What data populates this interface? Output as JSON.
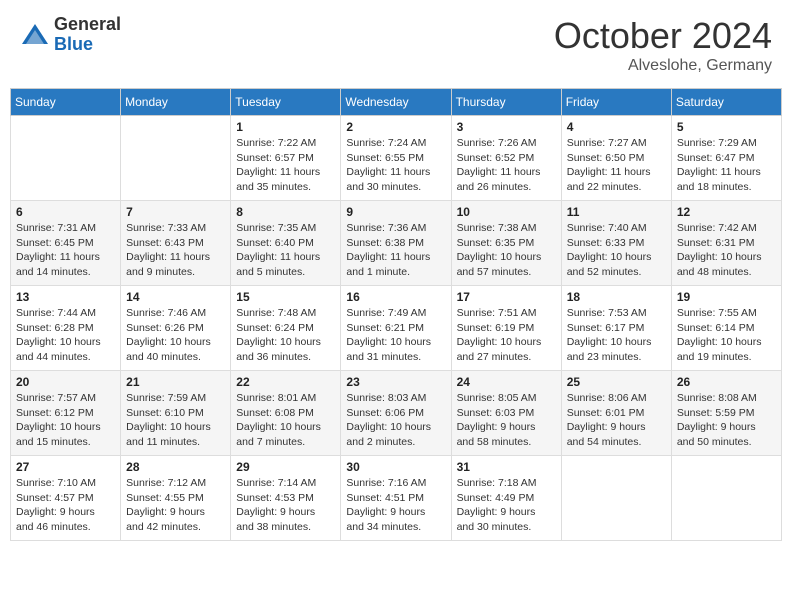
{
  "header": {
    "logo_general": "General",
    "logo_blue": "Blue",
    "month_title": "October 2024",
    "location": "Alveslohe, Germany"
  },
  "days_of_week": [
    "Sunday",
    "Monday",
    "Tuesday",
    "Wednesday",
    "Thursday",
    "Friday",
    "Saturday"
  ],
  "weeks": [
    [
      null,
      null,
      {
        "day": 1,
        "sunrise": "7:22 AM",
        "sunset": "6:57 PM",
        "daylight": "11 hours and 35 minutes."
      },
      {
        "day": 2,
        "sunrise": "7:24 AM",
        "sunset": "6:55 PM",
        "daylight": "11 hours and 30 minutes."
      },
      {
        "day": 3,
        "sunrise": "7:26 AM",
        "sunset": "6:52 PM",
        "daylight": "11 hours and 26 minutes."
      },
      {
        "day": 4,
        "sunrise": "7:27 AM",
        "sunset": "6:50 PM",
        "daylight": "11 hours and 22 minutes."
      },
      {
        "day": 5,
        "sunrise": "7:29 AM",
        "sunset": "6:47 PM",
        "daylight": "11 hours and 18 minutes."
      }
    ],
    [
      {
        "day": 6,
        "sunrise": "7:31 AM",
        "sunset": "6:45 PM",
        "daylight": "11 hours and 14 minutes."
      },
      {
        "day": 7,
        "sunrise": "7:33 AM",
        "sunset": "6:43 PM",
        "daylight": "11 hours and 9 minutes."
      },
      {
        "day": 8,
        "sunrise": "7:35 AM",
        "sunset": "6:40 PM",
        "daylight": "11 hours and 5 minutes."
      },
      {
        "day": 9,
        "sunrise": "7:36 AM",
        "sunset": "6:38 PM",
        "daylight": "11 hours and 1 minute."
      },
      {
        "day": 10,
        "sunrise": "7:38 AM",
        "sunset": "6:35 PM",
        "daylight": "10 hours and 57 minutes."
      },
      {
        "day": 11,
        "sunrise": "7:40 AM",
        "sunset": "6:33 PM",
        "daylight": "10 hours and 52 minutes."
      },
      {
        "day": 12,
        "sunrise": "7:42 AM",
        "sunset": "6:31 PM",
        "daylight": "10 hours and 48 minutes."
      }
    ],
    [
      {
        "day": 13,
        "sunrise": "7:44 AM",
        "sunset": "6:28 PM",
        "daylight": "10 hours and 44 minutes."
      },
      {
        "day": 14,
        "sunrise": "7:46 AM",
        "sunset": "6:26 PM",
        "daylight": "10 hours and 40 minutes."
      },
      {
        "day": 15,
        "sunrise": "7:48 AM",
        "sunset": "6:24 PM",
        "daylight": "10 hours and 36 minutes."
      },
      {
        "day": 16,
        "sunrise": "7:49 AM",
        "sunset": "6:21 PM",
        "daylight": "10 hours and 31 minutes."
      },
      {
        "day": 17,
        "sunrise": "7:51 AM",
        "sunset": "6:19 PM",
        "daylight": "10 hours and 27 minutes."
      },
      {
        "day": 18,
        "sunrise": "7:53 AM",
        "sunset": "6:17 PM",
        "daylight": "10 hours and 23 minutes."
      },
      {
        "day": 19,
        "sunrise": "7:55 AM",
        "sunset": "6:14 PM",
        "daylight": "10 hours and 19 minutes."
      }
    ],
    [
      {
        "day": 20,
        "sunrise": "7:57 AM",
        "sunset": "6:12 PM",
        "daylight": "10 hours and 15 minutes."
      },
      {
        "day": 21,
        "sunrise": "7:59 AM",
        "sunset": "6:10 PM",
        "daylight": "10 hours and 11 minutes."
      },
      {
        "day": 22,
        "sunrise": "8:01 AM",
        "sunset": "6:08 PM",
        "daylight": "10 hours and 7 minutes."
      },
      {
        "day": 23,
        "sunrise": "8:03 AM",
        "sunset": "6:06 PM",
        "daylight": "10 hours and 2 minutes."
      },
      {
        "day": 24,
        "sunrise": "8:05 AM",
        "sunset": "6:03 PM",
        "daylight": "9 hours and 58 minutes."
      },
      {
        "day": 25,
        "sunrise": "8:06 AM",
        "sunset": "6:01 PM",
        "daylight": "9 hours and 54 minutes."
      },
      {
        "day": 26,
        "sunrise": "8:08 AM",
        "sunset": "5:59 PM",
        "daylight": "9 hours and 50 minutes."
      }
    ],
    [
      {
        "day": 27,
        "sunrise": "7:10 AM",
        "sunset": "4:57 PM",
        "daylight": "9 hours and 46 minutes."
      },
      {
        "day": 28,
        "sunrise": "7:12 AM",
        "sunset": "4:55 PM",
        "daylight": "9 hours and 42 minutes."
      },
      {
        "day": 29,
        "sunrise": "7:14 AM",
        "sunset": "4:53 PM",
        "daylight": "9 hours and 38 minutes."
      },
      {
        "day": 30,
        "sunrise": "7:16 AM",
        "sunset": "4:51 PM",
        "daylight": "9 hours and 34 minutes."
      },
      {
        "day": 31,
        "sunrise": "7:18 AM",
        "sunset": "4:49 PM",
        "daylight": "9 hours and 30 minutes."
      },
      null,
      null
    ]
  ]
}
